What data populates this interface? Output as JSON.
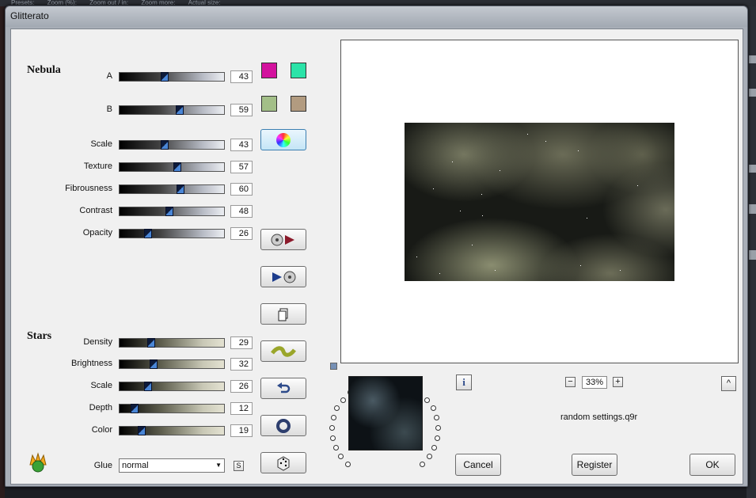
{
  "toolbar_strip": [
    "Presets:",
    "Zoom (%):",
    "Zoom out / in:",
    "Zoom more:",
    "Actual size:"
  ],
  "window": {
    "title": "Glitterato"
  },
  "nebula": {
    "section_label": "Nebula",
    "sliders": [
      {
        "label": "A",
        "value": "43",
        "fraction": 0.43
      },
      {
        "label": "B",
        "value": "59",
        "fraction": 0.59
      },
      {
        "label": "Scale",
        "value": "43",
        "fraction": 0.43
      },
      {
        "label": "Texture",
        "value": "57",
        "fraction": 0.57
      },
      {
        "label": "Fibrousness",
        "value": "60",
        "fraction": 0.6
      },
      {
        "label": "Contrast",
        "value": "48",
        "fraction": 0.48
      },
      {
        "label": "Opacity",
        "value": "26",
        "fraction": 0.26
      }
    ],
    "colors": {
      "a1": "#d3129e",
      "a2": "#2be3a8",
      "b1": "#a3bf88",
      "b2": "#b29b80"
    }
  },
  "stars": {
    "section_label": "Stars",
    "sliders": [
      {
        "label": "Density",
        "value": "29",
        "fraction": 0.29
      },
      {
        "label": "Brightness",
        "value": "32",
        "fraction": 0.32
      },
      {
        "label": "Scale",
        "value": "26",
        "fraction": 0.26
      },
      {
        "label": "Depth",
        "value": "12",
        "fraction": 0.12
      },
      {
        "label": "Color",
        "value": "19",
        "fraction": 0.19
      }
    ]
  },
  "glue": {
    "label": "Glue",
    "value": "normal",
    "lock": "S"
  },
  "zoom": {
    "value": "33%",
    "minus": "−",
    "plus": "+"
  },
  "info_label": "i",
  "expand_label": "^",
  "preset_name": "random settings.q9r",
  "buttons": {
    "cancel": "Cancel",
    "register": "Register",
    "ok": "OK"
  }
}
